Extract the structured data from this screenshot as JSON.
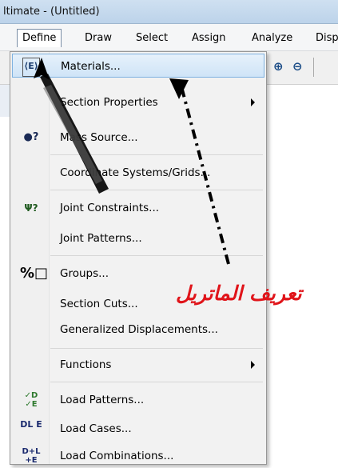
{
  "window": {
    "title": "ltimate - (Untitled)"
  },
  "menubar": {
    "items": [
      {
        "label": "Define",
        "active": true
      },
      {
        "label": "Draw"
      },
      {
        "label": "Select"
      },
      {
        "label": "Assign"
      },
      {
        "label": "Analyze"
      },
      {
        "label": "Disp"
      }
    ]
  },
  "define_menu": {
    "items": [
      {
        "label": "Materials...",
        "icon": "materials-icon",
        "highlighted": true
      },
      {
        "label": "Section Properties",
        "submenu": true
      },
      {
        "label": "Mass Source...",
        "icon": "mass-source-icon"
      },
      {
        "label": "Coordinate Systems/Grids..."
      },
      {
        "label": "Joint Constraints...",
        "icon": "joint-constraints-icon"
      },
      {
        "label": "Joint Patterns..."
      },
      {
        "label": "Groups...",
        "icon": "groups-icon"
      },
      {
        "label": "Section Cuts..."
      },
      {
        "label": "Generalized Displacements..."
      },
      {
        "label": "Functions",
        "submenu": true
      },
      {
        "label": "Load Patterns...",
        "icon": "load-patterns-icon"
      },
      {
        "label": "Load Cases...",
        "icon": "load-cases-icon"
      },
      {
        "label": "Load Combinations...",
        "icon": "load-combinations-icon"
      }
    ]
  },
  "annotation": {
    "text": "تعريف الماتريل",
    "color": "#e0141a"
  },
  "icons": {
    "materials": "⟨E⟩",
    "mass_source": "●?",
    "joint_constraints": "Ψ?",
    "groups": "%□",
    "load_patterns": "✓D ✓E",
    "load_cases": "DL E",
    "load_combinations": "D+L +E",
    "zoom_in": "⊕",
    "zoom_out": "⊖"
  }
}
